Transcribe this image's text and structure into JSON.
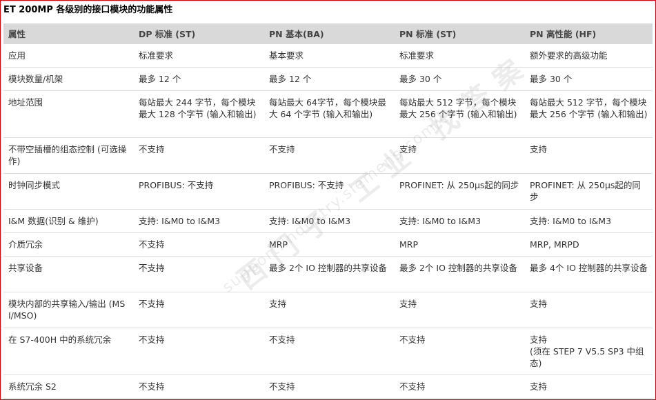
{
  "title": "ET 200MP 各级别的接口模块的功能属性",
  "headers": [
    "属性",
    "DP 标准 (ST)",
    "PN 基本(BA)",
    "PN 标准 (ST)",
    "PN 高性能 (HF)"
  ],
  "rows": [
    [
      "应用",
      "标准要求",
      "基本要求",
      "标准要求",
      "额外要求的高级功能"
    ],
    [
      "模块数量/机架",
      "最多 12 个",
      "最多 12 个",
      "最多 30 个",
      "最多 30 个"
    ],
    [
      "地址范围",
      "每站最大 244 字节，每个模块最大 128 个字节 (输入和输出)",
      "每站最大 64字节，每个模块最大 64 个字节 (输入和输出)",
      "每站最大 512 字节，每个模块最大 256 个字节 (输入和输出)",
      "每站最大 512 字节，每个模块最大 256 个字节 (输入和输出)"
    ],
    [
      "不带空插槽的组态控制 (可选操作)",
      "不支持",
      "不支持",
      "支持",
      "支持"
    ],
    [
      "时钟同步模式",
      "PROFIBUS: 不支持",
      "PROFIBUS: 不支持",
      "PROFINET: 从 250μs起的同步",
      "PROFINET: 从 250μs起的同步"
    ],
    [
      "I&M 数据(识别 & 维护)",
      "支持: I&M0 to I&M3",
      "支持: I&M0 to I&M3",
      "支持: I&M0 to I&M3",
      "支持: I&M0 to I&M3"
    ],
    [
      "介质冗余",
      "不支持",
      "MRP",
      "MRP",
      "MRP, MRPD"
    ],
    [
      "共享设备",
      "不支持",
      "最多 2个 IO 控制器的共享设备",
      "最多 2个 IO 控制器的共享设备",
      "最多 4个 IO 控制器的共享设备"
    ],
    [
      "模块内部的共享输入/输出 (MSI/MSO)",
      "不支持",
      "支持",
      "支持",
      "支持"
    ],
    [
      "在 S7-400H 中的系统冗余",
      "不支持",
      "不支持",
      "不支持",
      "支持\n(须在 STEP 7 V5.5 SP3 中组态)"
    ],
    [
      "系统冗余 S2",
      "不支持",
      "不支持",
      "不支持",
      "支持"
    ]
  ],
  "watermark": {
    "line1": "西门子 工业 找答案",
    "line2": "support.industry.siemens.com/cs"
  },
  "colors": {
    "border": "#cc0000",
    "header_bg": "#d9d9d9"
  }
}
